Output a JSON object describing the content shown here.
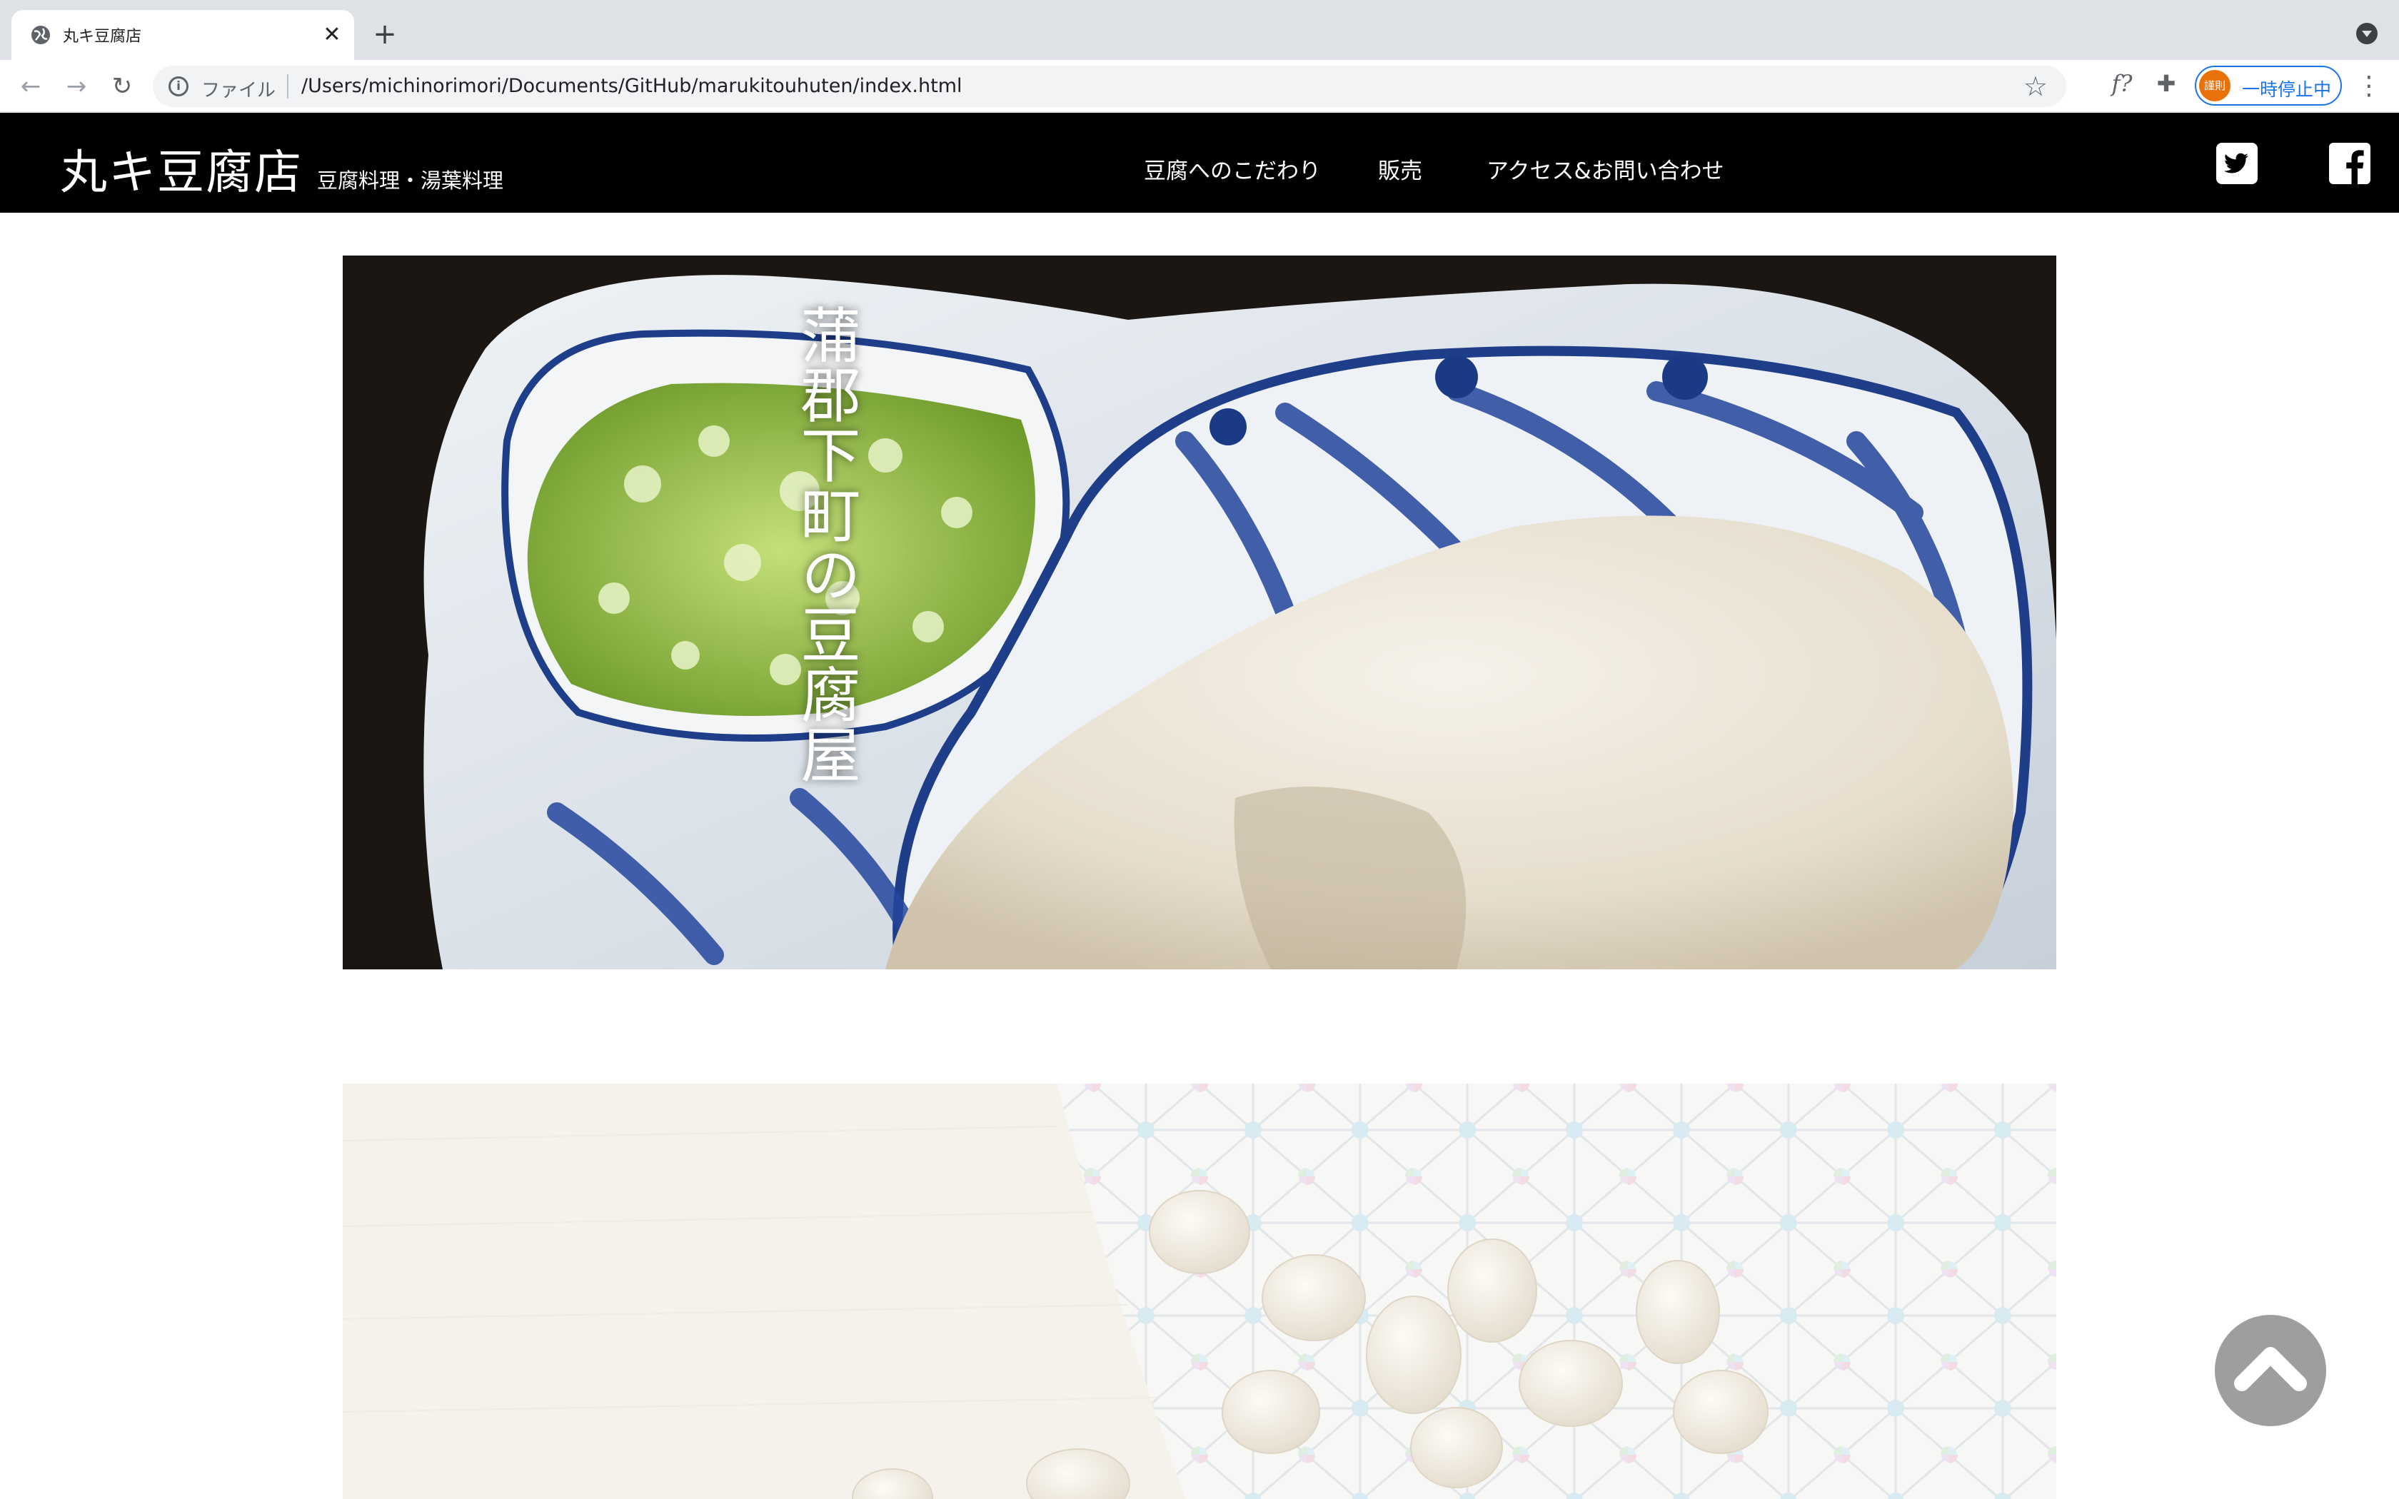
{
  "browser": {
    "tab_title": "丸キ豆腐店",
    "tab_close": "✕",
    "new_tab": "+",
    "nav": {
      "back": "←",
      "forward": "→",
      "reload": "↻"
    },
    "omnibox": {
      "info_icon": "i",
      "scheme_label": "ファイル",
      "url": "/Users/michinorimori/Documents/GitHub/marukitouhuten/index.html"
    },
    "extensions": {
      "fx_label": "f?",
      "puzzle_glyph": "✚"
    },
    "profile": {
      "avatar_text": "謹則",
      "label": "一時停止中"
    },
    "menu_glyph": "⋮",
    "star_glyph": "☆"
  },
  "site": {
    "logo": "丸キ豆腐店",
    "tagline": "豆腐料理・湯葉料理",
    "nav": [
      {
        "label": "豆腐へのこだわり"
      },
      {
        "label": "販売"
      },
      {
        "label": "アクセス&お問い合わせ"
      }
    ],
    "social": [
      {
        "icon": "twitter-icon"
      },
      {
        "icon": "facebook-icon"
      }
    ],
    "hero": {
      "copy": "蒲郡下町の豆腐屋"
    },
    "back_to_top_icon": "chevron-up-icon"
  }
}
